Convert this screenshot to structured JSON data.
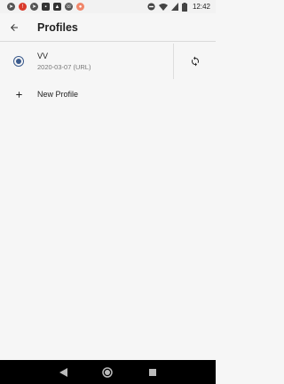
{
  "status_bar": {
    "time": "12:42",
    "notification_icons": [
      "telegram-icon",
      "red-notification-icon",
      "telegram-icon",
      "square-app-icon",
      "image-icon",
      "phone-icon",
      "app-orange-icon"
    ],
    "system_icons": [
      "dnd-icon",
      "wifi-icon",
      "signal-icon",
      "battery-icon"
    ]
  },
  "app_bar": {
    "title": "Profiles",
    "back_icon": "arrow-back-icon"
  },
  "profiles": [
    {
      "name": "VV",
      "subtitle": "2020-03-07 (URL)",
      "selected": true
    }
  ],
  "new_profile": {
    "label": "New Profile",
    "icon": "plus-icon"
  },
  "nav_bar": {
    "buttons": [
      "back-triangle-icon",
      "home-circle-icon",
      "recents-square-icon"
    ]
  },
  "colors": {
    "accent": "#3a5a8c",
    "background": "#f6f6f6",
    "nav_background": "#000000"
  }
}
